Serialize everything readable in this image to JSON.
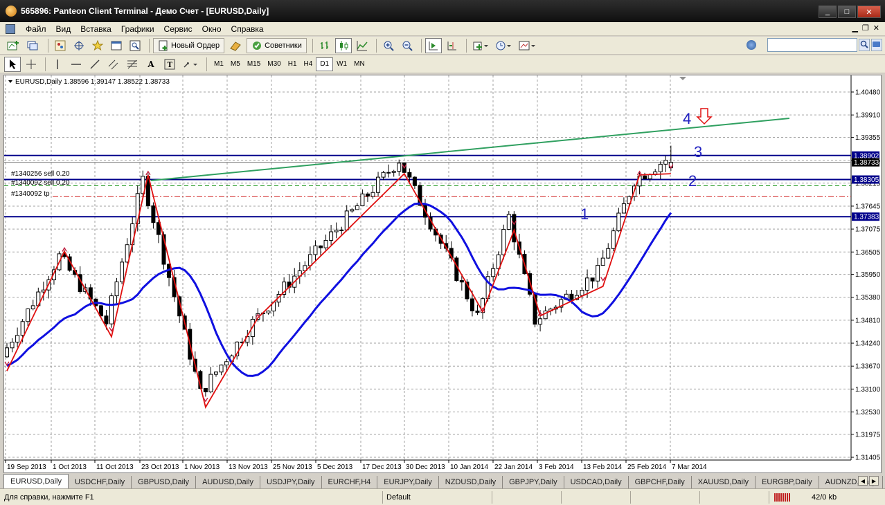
{
  "window": {
    "title": "565896: Panteon Client Terminal - Демо Счет - [EURUSD,Daily]",
    "minimize_label": "_",
    "maximize_label": "□",
    "close_label": "✕"
  },
  "menu": {
    "items": [
      "Файл",
      "Вид",
      "Вставка",
      "Графики",
      "Сервис",
      "Окно",
      "Справка"
    ]
  },
  "toolbar": {
    "new_order_label": "Новый Ордер",
    "experts_label": "Советники",
    "timeframes": [
      "M1",
      "M5",
      "M15",
      "M30",
      "H1",
      "H4",
      "D1",
      "W1",
      "MN"
    ],
    "active_timeframe": "D1"
  },
  "chart": {
    "header": "EURUSD,Daily  1.38596 1.39147 1.38522 1.38733",
    "order_labels": [
      "#1340256 sell 0.20",
      "#1340092 sell 0.20",
      "#1340092 tp"
    ],
    "wave_labels": [
      "1",
      "2",
      "3",
      "4"
    ],
    "price_ticks": [
      "1.40480",
      "1.39910",
      "1.39355",
      "1.38785",
      "1.38215",
      "1.37645",
      "1.37075",
      "1.36505",
      "1.35950",
      "1.35380",
      "1.34810",
      "1.34240",
      "1.33670",
      "1.33100",
      "1.32530",
      "1.31975",
      "1.31405"
    ],
    "price_tags": {
      "upper_level": "1.38902",
      "current": "1.38733",
      "middle_level": "1.38305",
      "lower_level": "1.37383"
    },
    "date_ticks": [
      "19 Sep 2013",
      "1 Oct 2013",
      "11 Oct 2013",
      "23 Oct 2013",
      "1 Nov 2013",
      "13 Nov 2013",
      "25 Nov 2013",
      "5 Dec 2013",
      "17 Dec 2013",
      "30 Dec 2013",
      "10 Jan 2014",
      "22 Jan 2014",
      "3 Feb 2014",
      "13 Feb 2014",
      "25 Feb 2014",
      "7 Mar 2014"
    ],
    "colors": {
      "bull": "#ffffff",
      "bear": "#000000",
      "ma": "#1010e0",
      "zigzag": "#e01010",
      "trend": "#30a060",
      "level": "#00008b"
    }
  },
  "tabs": {
    "items": [
      "EURUSD,Daily",
      "USDCHF,Daily",
      "GBPUSD,Daily",
      "AUDUSD,Daily",
      "USDJPY,Daily",
      "EURCHF,H4",
      "EURJPY,Daily",
      "NZDUSD,Daily",
      "GBPJPY,Daily",
      "USDCAD,Daily",
      "GBPCHF,Daily",
      "XAUUSD,Daily",
      "EURGBP,Daily",
      "AUDNZD,Daily"
    ],
    "active": "EURUSD,Daily"
  },
  "status": {
    "help": "Для справки, нажмите F1",
    "profile": "Default",
    "traffic": "42/0 kb"
  }
}
